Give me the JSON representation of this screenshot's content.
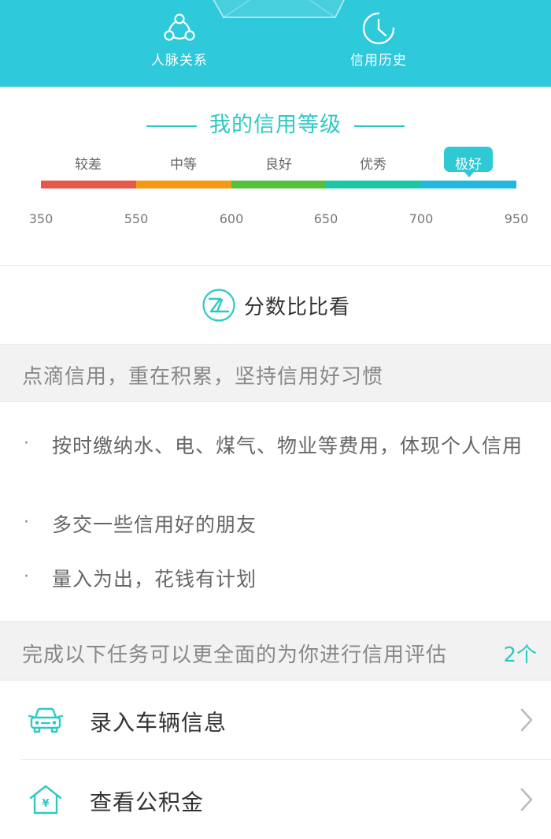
{
  "header": {
    "actions": [
      {
        "label": "人脉关系",
        "icon": "people-network-icon"
      },
      {
        "label": "信用历史",
        "icon": "clock-icon"
      }
    ]
  },
  "credit_level": {
    "title": "我的信用等级",
    "levels": [
      {
        "label": "较差",
        "color": "#e8584a"
      },
      {
        "label": "中等",
        "color": "#f39a12"
      },
      {
        "label": "良好",
        "color": "#55c13a"
      },
      {
        "label": "优秀",
        "color": "#1bc7a6"
      },
      {
        "label": "极好",
        "color": "#21b7df"
      }
    ],
    "current_level": "极好",
    "scores": [
      "350",
      "550",
      "600",
      "650",
      "700",
      "950"
    ]
  },
  "compare": {
    "label": "分数比比看",
    "icon": "zl-logo-icon"
  },
  "tips": {
    "header": "点滴信用，重在积累，坚持信用好习惯",
    "items": [
      "按时缴纳水、电、煤气、物业等费用，体现个人信用",
      "多交一些信用好的朋友",
      "量入为出，花钱有计划"
    ]
  },
  "tasks": {
    "header": "完成以下任务可以更全面的为你进行信用评估",
    "count": "2个",
    "items": [
      {
        "label": "录入车辆信息",
        "icon": "car-icon"
      },
      {
        "label": "查看公积金",
        "icon": "house-fund-icon"
      }
    ]
  },
  "colors": {
    "accent": "#2ec9da",
    "accent_text": "#2ec9c4"
  }
}
